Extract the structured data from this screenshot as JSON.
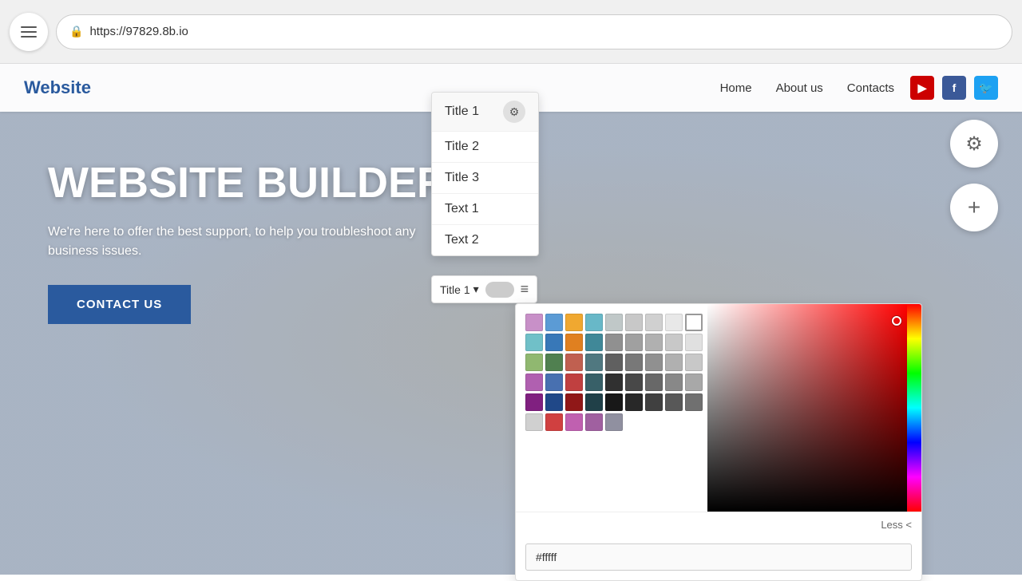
{
  "browser": {
    "url": "https://97829.8b.io",
    "lock_symbol": "🔒"
  },
  "header": {
    "logo": "Website",
    "nav": {
      "home": "Home",
      "about": "About us",
      "contacts": "Contacts"
    }
  },
  "hero": {
    "title": "WEBSITE BUILDER",
    "subtitle": "We're here to offer the best support, to help you troubleshoot any business issues.",
    "cta": "CONTACT US"
  },
  "dropdown": {
    "items": [
      {
        "label": "Title 1",
        "has_settings": true
      },
      {
        "label": "Title 2"
      },
      {
        "label": "Title 3"
      },
      {
        "label": "Text 1"
      },
      {
        "label": "Text 2"
      }
    ],
    "current": "Title 1"
  },
  "toolbar": {
    "label": "Title 1",
    "chevron": "▾"
  },
  "color_picker": {
    "hex_value": "#fffff",
    "less_label": "Less <",
    "swatches": [
      "#d4a0d4",
      "#5b9bd5",
      "#f0a830",
      "#68b8c8",
      "#c8c8c8",
      "#c8c8c8",
      "#c8c8c8",
      "#e8e8e8",
      "#ffffff",
      "#7ec8d4",
      "#3888c0",
      "#e88820",
      "#409098",
      "#a0a0a0",
      "#a8a8a8",
      "#b0b0b0",
      "#d0d0d0",
      "#e8e8e8",
      "#90b870",
      "#508050",
      "#c06050",
      "#507880",
      "#606060",
      "#808080",
      "#989898",
      "#b8b8b8",
      "#d0d0d0",
      "#b060b0",
      "#4870b0",
      "#b04040",
      "#386068",
      "#303030",
      "#484848",
      "#686868",
      "#888888",
      "#a8a8a8",
      "#802080",
      "#204888",
      "#901818",
      "#204048",
      "#181818",
      "#282828",
      "#484848",
      "#606060",
      "#787878",
      "#c0c0c0",
      "#d04040",
      "#c060b0",
      "#a060a0",
      "#9090a0"
    ]
  },
  "fabs": {
    "settings_icon": "⚙",
    "add_icon": "+"
  }
}
